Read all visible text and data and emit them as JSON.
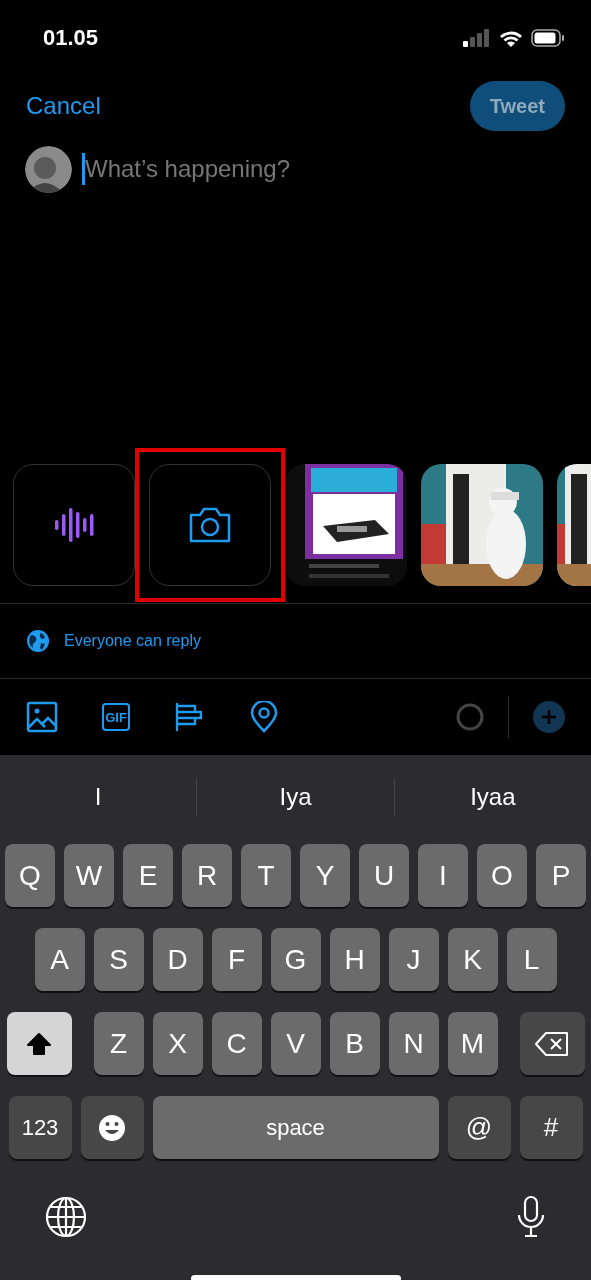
{
  "status_bar": {
    "time": "01.05"
  },
  "header": {
    "cancel": "Cancel",
    "tweet": {
      "label": "Tweet",
      "disabled": true
    }
  },
  "compose": {
    "placeholder": "What’s happening?"
  },
  "media_row": [
    {
      "kind": "voice",
      "highlighted": false
    },
    {
      "kind": "camera",
      "highlighted": true
    },
    {
      "kind": "picture",
      "highlighted": false
    },
    {
      "kind": "picture",
      "highlighted": false
    },
    {
      "kind": "picture",
      "highlighted": false
    }
  ],
  "reply_setting": "Everyone can reply",
  "toolbar": {
    "gif_label": "GIF"
  },
  "keyboard": {
    "suggestions": [
      "I",
      "Iya",
      "Iyaa"
    ],
    "rows": [
      {
        "keys": [
          {
            "kind": "letter",
            "label": "Q"
          },
          {
            "kind": "letter",
            "label": "W"
          },
          {
            "kind": "letter",
            "label": "E"
          },
          {
            "kind": "letter",
            "label": "R"
          },
          {
            "kind": "letter",
            "label": "T"
          },
          {
            "kind": "letter",
            "label": "Y"
          },
          {
            "kind": "letter",
            "label": "U"
          },
          {
            "kind": "letter",
            "label": "I"
          },
          {
            "kind": "letter",
            "label": "O"
          },
          {
            "kind": "letter",
            "label": "P"
          }
        ]
      },
      {
        "keys": [
          {
            "kind": "letter",
            "label": "A"
          },
          {
            "kind": "letter",
            "label": "S"
          },
          {
            "kind": "letter",
            "label": "D"
          },
          {
            "kind": "letter",
            "label": "F"
          },
          {
            "kind": "letter",
            "label": "G"
          },
          {
            "kind": "letter",
            "label": "H"
          },
          {
            "kind": "letter",
            "label": "J"
          },
          {
            "kind": "letter",
            "label": "K"
          },
          {
            "kind": "letter",
            "label": "L"
          }
        ]
      },
      {
        "keys": [
          {
            "kind": "shift",
            "on": true
          },
          {
            "kind": "letter",
            "label": "Z"
          },
          {
            "kind": "letter",
            "label": "X"
          },
          {
            "kind": "letter",
            "label": "C"
          },
          {
            "kind": "letter",
            "label": "V"
          },
          {
            "kind": "letter",
            "label": "B"
          },
          {
            "kind": "letter",
            "label": "N"
          },
          {
            "kind": "letter",
            "label": "M"
          },
          {
            "kind": "backspace"
          }
        ]
      },
      {
        "keys": [
          {
            "kind": "mode",
            "label": "123"
          },
          {
            "kind": "emoji"
          },
          {
            "kind": "space",
            "label": "space"
          },
          {
            "kind": "symbol",
            "label": "@"
          },
          {
            "kind": "symbol",
            "label": "#"
          }
        ]
      }
    ]
  }
}
